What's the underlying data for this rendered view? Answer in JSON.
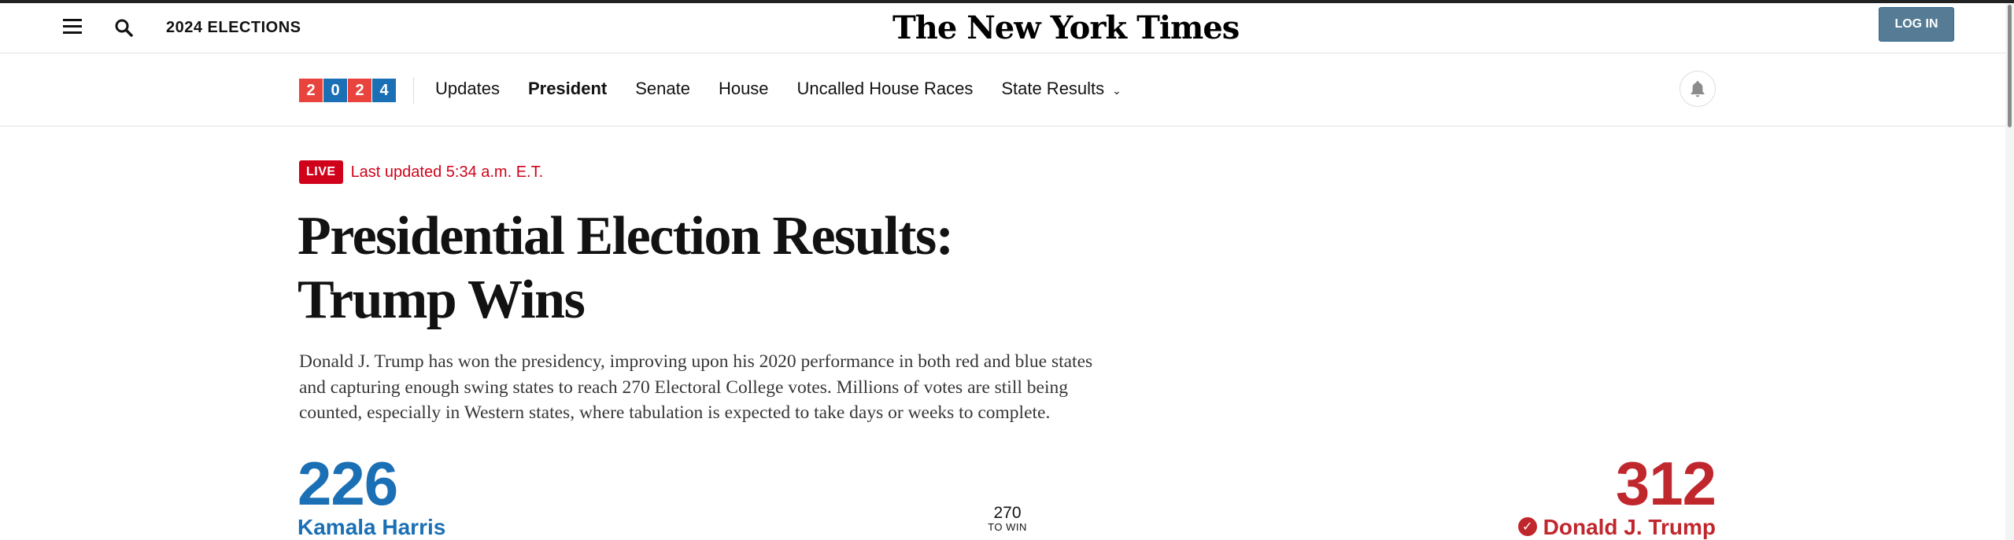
{
  "masthead": {
    "section_label": "2024 ELECTIONS",
    "logo_text": "The New York Times",
    "login_label": "LOG IN",
    "login_color": "#567b95"
  },
  "subnav": {
    "year_digits": [
      "2",
      "0",
      "2",
      "4"
    ],
    "year_colors": [
      "#e8433d",
      "#1a6fb5",
      "#e8433d",
      "#1a6fb5"
    ],
    "links": [
      {
        "label": "Updates",
        "active": false
      },
      {
        "label": "President",
        "active": true
      },
      {
        "label": "Senate",
        "active": false
      },
      {
        "label": "House",
        "active": false
      },
      {
        "label": "Uncalled House Races",
        "active": false
      },
      {
        "label": "State Results",
        "active": false,
        "dropdown": true
      }
    ],
    "icons": {
      "menu": "hamburger-menu-icon",
      "search": "search-icon",
      "bell": "bell-icon",
      "chevron": "chevron-down-icon"
    }
  },
  "article": {
    "live_label": "LIVE",
    "updated": "Last updated 5:34 a.m. E.T.",
    "headline_line1": "Presidential Election Results:",
    "headline_line2": "Trump Wins",
    "dek": "Donald J. Trump has won the presidency, improving upon his 2020 performance in both red and blue states and capturing enough swing states to reach 270 Electoral College votes. Millions of votes are still being counted, especially in Western states, where tabulation is expected to take days or weeks to complete."
  },
  "tally": {
    "harris": {
      "votes": "226",
      "name": "Kamala Harris",
      "color": "#1a6fb5"
    },
    "trump": {
      "votes": "312",
      "name": "Donald J. Trump",
      "color": "#c0272d",
      "winner": true
    },
    "threshold": {
      "number": "270",
      "label": "TO WIN"
    }
  }
}
